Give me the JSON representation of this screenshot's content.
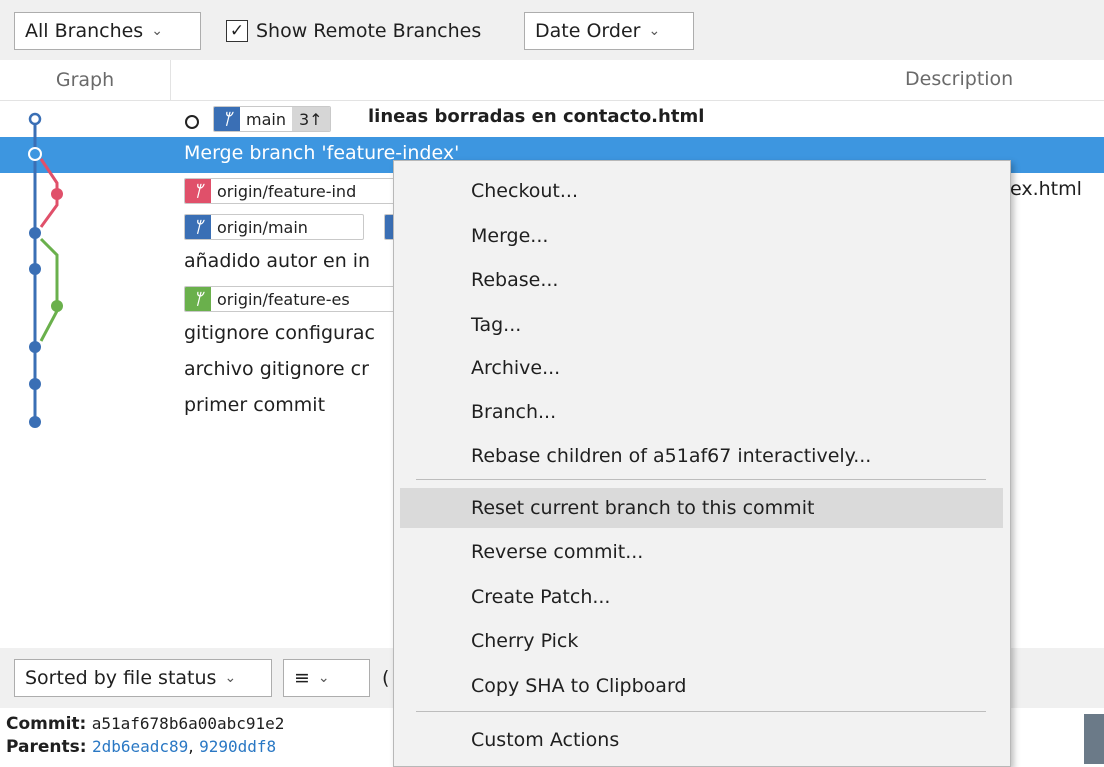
{
  "toolbar": {
    "branches_dropdown": "All Branches",
    "show_remote_label": "Show Remote Branches",
    "show_remote_checked": true,
    "order_dropdown": "Date Order"
  },
  "header": {
    "graph": "Graph",
    "description": "Description"
  },
  "commits": [
    {
      "message": "lineas borradas en contacto.html",
      "branch": "main",
      "ahead": "3↑"
    },
    {
      "message": "Merge branch 'feature-index'"
    },
    {
      "branch": "origin/feature-ind",
      "trailing": "ex.html"
    },
    {
      "branch": "origin/main"
    },
    {
      "message": "añadido autor en in"
    },
    {
      "branch": "origin/feature-es"
    },
    {
      "message": "gitignore configurac"
    },
    {
      "message": "archivo gitignore cr"
    },
    {
      "message": "primer commit"
    }
  ],
  "bottom": {
    "sort_dropdown": "Sorted by file status",
    "view_icon": "list-icon",
    "paren": "(",
    "commit_label": "Commit:",
    "commit_value": "a51af678b6a00abc91e2",
    "parents_label": "Parents:",
    "parent1": "2db6eadc89",
    "parent_sep": ",",
    "parent2": "9290ddf8"
  },
  "context_menu": {
    "items": [
      "Checkout...",
      "Merge...",
      "Rebase...",
      "Tag...",
      "Archive...",
      "Branch...",
      "Rebase children of a51af67 interactively...",
      "Reset current branch to this commit",
      "Reverse commit...",
      "Create Patch...",
      "Cherry Pick",
      "Copy SHA to Clipboard",
      "Custom Actions"
    ]
  },
  "colors": {
    "selection": "#3d96e0",
    "branch_blue": "#3a6fb5",
    "branch_red": "#e0506a",
    "branch_green": "#6ab04c"
  }
}
